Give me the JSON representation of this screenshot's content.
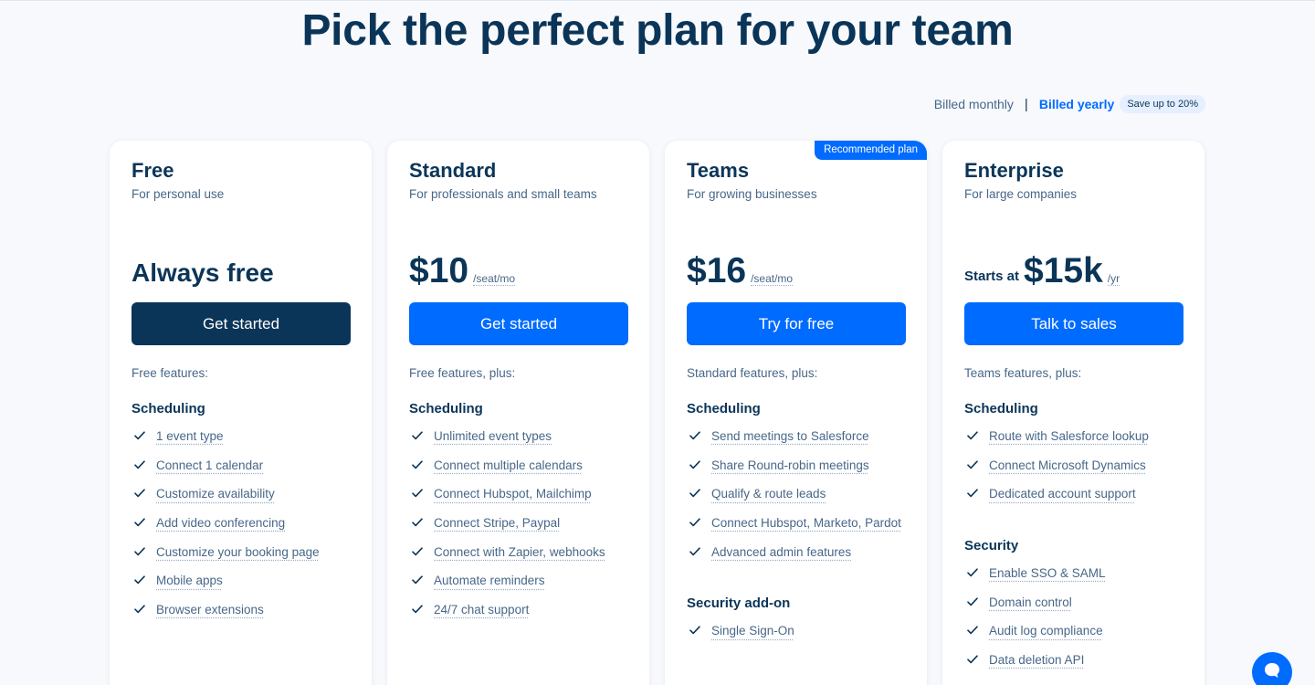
{
  "page": {
    "headline": "Pick the perfect plan for your team"
  },
  "billing": {
    "monthly_label": "Billed monthly",
    "separator": "|",
    "yearly_label": "Billed yearly",
    "selected": "yearly",
    "save_badge": "Save up to 20%"
  },
  "colors": {
    "primary_blue": "#006bff",
    "navy": "#0b3558",
    "muted_text": "#476788",
    "background": "#f7f9fc"
  },
  "plans": [
    {
      "name": "Free",
      "description": "For personal use",
      "price_text": "Always free",
      "cta": "Get started",
      "features_intro": "Free features:",
      "sections": [
        {
          "title": "Scheduling",
          "items": [
            "1 event type",
            "Connect 1 calendar",
            "Customize availability",
            "Add video conferencing",
            "Customize your booking page",
            "Mobile apps",
            "Browser extensions"
          ]
        }
      ]
    },
    {
      "name": "Standard",
      "description": "For professionals and small teams",
      "price": "$10",
      "unit": "/seat/mo",
      "cta": "Get started",
      "features_intro": "Free features, plus:",
      "sections": [
        {
          "title": "Scheduling",
          "items": [
            "Unlimited event types",
            "Connect multiple calendars",
            "Connect Hubspot, Mailchimp",
            "Connect Stripe, Paypal",
            "Connect with Zapier, webhooks",
            "Automate reminders",
            "24/7 chat support"
          ]
        }
      ]
    },
    {
      "name": "Teams",
      "description": "For growing businesses",
      "ribbon": "Recommended plan",
      "price": "$16",
      "unit": "/seat/mo",
      "cta": "Try for free",
      "features_intro": "Standard features, plus:",
      "sections": [
        {
          "title": "Scheduling",
          "items": [
            "Send meetings to Salesforce",
            "Share Round-robin meetings",
            "Qualify & route leads",
            "Connect Hubspot, Marketo, Pardot",
            "Advanced admin features"
          ]
        },
        {
          "title": "Security add-on",
          "items": [
            "Single Sign-On"
          ]
        }
      ]
    },
    {
      "name": "Enterprise",
      "description": "For large companies",
      "price_prefix": "Starts at",
      "price": "$15k",
      "unit": "/yr",
      "cta": "Talk to sales",
      "features_intro": "Teams features, plus:",
      "sections": [
        {
          "title": "Scheduling",
          "items": [
            "Route with Salesforce lookup",
            "Connect Microsoft Dynamics",
            "Dedicated account support"
          ]
        },
        {
          "title": "Security",
          "items": [
            "Enable SSO & SAML",
            "Domain control",
            "Audit log compliance",
            "Data deletion API"
          ]
        }
      ]
    }
  ],
  "icons": {
    "feature_check": "check-icon",
    "chat": "chat-bubble-icon"
  }
}
